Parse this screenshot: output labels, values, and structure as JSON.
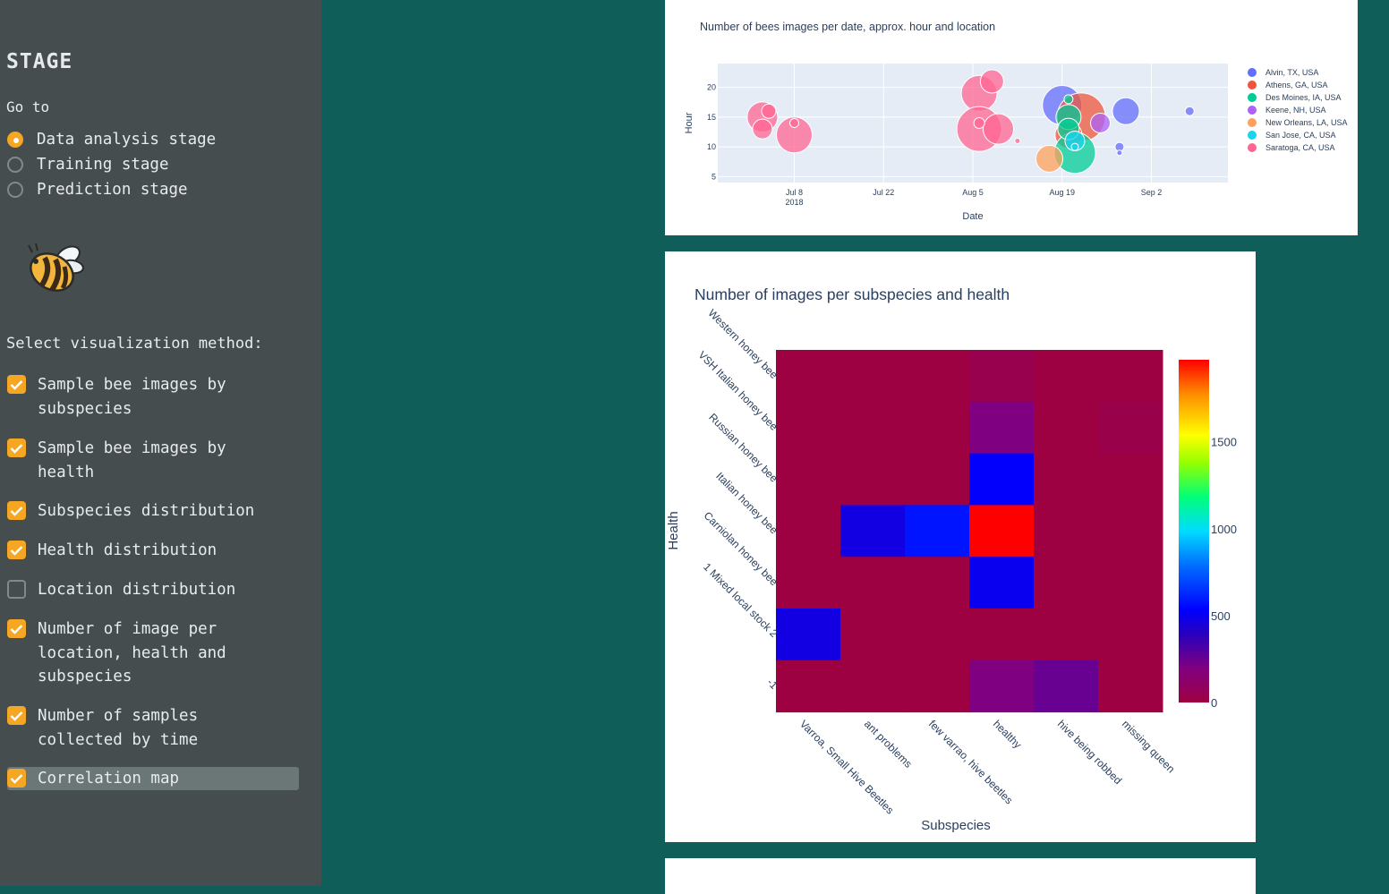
{
  "sidebar": {
    "stage_title": "STAGE",
    "goto_label": "Go to",
    "stages": [
      {
        "label": "Data analysis stage",
        "selected": true
      },
      {
        "label": "Training stage",
        "selected": false
      },
      {
        "label": "Prediction stage",
        "selected": false
      }
    ],
    "viz_label": "Select visualization method:",
    "viz_options": [
      {
        "label": "Sample bee images by subspecies",
        "checked": true
      },
      {
        "label": "Sample bee images by health",
        "checked": true
      },
      {
        "label": "Subspecies distribution",
        "checked": true
      },
      {
        "label": "Health distribution",
        "checked": true
      },
      {
        "label": "Location distribution",
        "checked": false
      },
      {
        "label": "Number of image per location, health and subspecies",
        "checked": true
      },
      {
        "label": "Number of samples collected by time",
        "checked": true
      },
      {
        "label": "Correlation map",
        "checked": true
      }
    ],
    "accent_color": "#f5a623"
  },
  "chart_data": [
    {
      "type": "scatter",
      "title": "Number of bees images per date, approx. hour and location",
      "xlabel": "Date",
      "ylabel": "Hour",
      "x_ticks": [
        "Jul 8",
        "Jul 22",
        "Aug 5",
        "Aug 19",
        "Sep 2"
      ],
      "x_tick_sub": "2018",
      "y_ticks": [
        5,
        10,
        15,
        20
      ],
      "ylim": [
        4,
        24
      ],
      "xlim": [
        "2018-06-26",
        "2018-09-14"
      ],
      "legend_position": "right",
      "series": [
        {
          "name": "Alvin, TX, USA",
          "color": "#636efa",
          "points": [
            {
              "x": "2018-08-19",
              "y": 17,
              "size": 44
            },
            {
              "x": "2018-08-29",
              "y": 16,
              "size": 30
            },
            {
              "x": "2018-08-28",
              "y": 10,
              "size": 10
            },
            {
              "x": "2018-08-28",
              "y": 9,
              "size": 6
            },
            {
              "x": "2018-09-08",
              "y": 16,
              "size": 10
            }
          ]
        },
        {
          "name": "Athens, GA, USA",
          "color": "#ef553b",
          "points": [
            {
              "x": "2018-08-22",
              "y": 15,
              "size": 54
            },
            {
              "x": "2018-08-20",
              "y": 12,
              "size": 30
            }
          ]
        },
        {
          "name": "Des Moines, IA, USA",
          "color": "#00cc96",
          "points": [
            {
              "x": "2018-08-21",
              "y": 9,
              "size": 46
            },
            {
              "x": "2018-08-20",
              "y": 15,
              "size": 28
            },
            {
              "x": "2018-08-20",
              "y": 13,
              "size": 24
            },
            {
              "x": "2018-08-20",
              "y": 18,
              "size": 10
            }
          ]
        },
        {
          "name": "Keene, NH, USA",
          "color": "#ab63fa",
          "points": [
            {
              "x": "2018-08-25",
              "y": 14,
              "size": 22
            }
          ]
        },
        {
          "name": "New Orleans, LA, USA",
          "color": "#ffa15a",
          "points": [
            {
              "x": "2018-08-17",
              "y": 8,
              "size": 30
            }
          ]
        },
        {
          "name": "San Jose, CA, USA",
          "color": "#19d3f3",
          "points": [
            {
              "x": "2018-08-21",
              "y": 11,
              "size": 22
            },
            {
              "x": "2018-08-21",
              "y": 10,
              "size": 8
            }
          ]
        },
        {
          "name": "Saratoga, CA, USA",
          "color": "#ff6692",
          "points": [
            {
              "x": "2018-07-03",
              "y": 15,
              "size": 34
            },
            {
              "x": "2018-07-03",
              "y": 13,
              "size": 22
            },
            {
              "x": "2018-07-04",
              "y": 16,
              "size": 16
            },
            {
              "x": "2018-07-08",
              "y": 12,
              "size": 40
            },
            {
              "x": "2018-07-08",
              "y": 14,
              "size": 10
            },
            {
              "x": "2018-08-06",
              "y": 19,
              "size": 40
            },
            {
              "x": "2018-08-08",
              "y": 21,
              "size": 26
            },
            {
              "x": "2018-08-06",
              "y": 13,
              "size": 50
            },
            {
              "x": "2018-08-09",
              "y": 13,
              "size": 34
            },
            {
              "x": "2018-08-06",
              "y": 14,
              "size": 12
            },
            {
              "x": "2018-08-12",
              "y": 11,
              "size": 6
            }
          ]
        }
      ]
    },
    {
      "type": "heatmap",
      "title": "Number of images per subspecies and health",
      "xlabel": "Subspecies",
      "ylabel": "Health",
      "x_categories": [
        "Varroa, Small Hive Beetles",
        "ant problems",
        "few varrao, hive beetles",
        "healthy",
        "hive being robbed",
        "missing queen"
      ],
      "y_categories": [
        "Western honey bee",
        "VSH Italian honey bee",
        "Russian honey bee",
        "Italian honey bee",
        "Carniolan honey bee",
        "1 Mixed local stock 2",
        "-1"
      ],
      "values": [
        [
          0,
          0,
          0,
          37,
          0,
          0
        ],
        [
          0,
          0,
          0,
          199,
          0,
          29
        ],
        [
          0,
          0,
          0,
          527,
          0,
          0
        ],
        [
          0,
          472,
          579,
          1972,
          0,
          0
        ],
        [
          0,
          0,
          0,
          501,
          0,
          0
        ],
        [
          472,
          0,
          0,
          0,
          0,
          0
        ],
        [
          0,
          0,
          0,
          200,
          251,
          0
        ]
      ],
      "colorbar_ticks": [
        0,
        500,
        1000,
        1500
      ],
      "zlim": [
        0,
        1972
      ]
    }
  ]
}
